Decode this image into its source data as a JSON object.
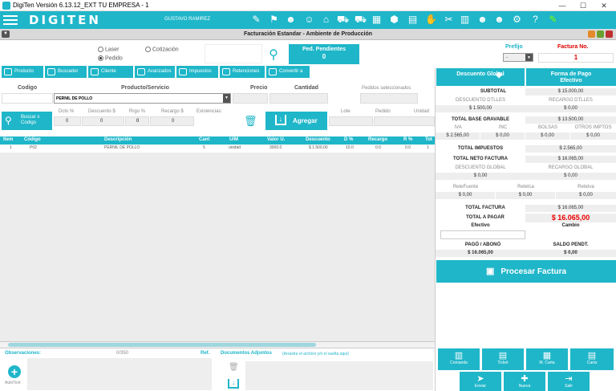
{
  "window": {
    "title": "DigiTen Versión 6.13.12_EXT TU EMPRESA - 1"
  },
  "app": {
    "logo": "DIGITEN",
    "user": "GUSTAVO RAMIREZ",
    "toolbar_icons": [
      "notes-icon",
      "ticket-icon",
      "users-icon",
      "search-users-icon",
      "tag-icon",
      "cart-icon",
      "cart-settings-icon",
      "box-icon",
      "cube-icon",
      "chart-icon",
      "hand-coins-icon",
      "tools-icon",
      "bar-chart-icon",
      "person-icon",
      "admin-icon",
      "gear-icon",
      "help-icon",
      "pen-icon"
    ]
  },
  "doc": {
    "title": "Facturación Estandar  -  Ambiente de Producción"
  },
  "modes": {
    "laser": "Laser",
    "cotizacion": "Cotización",
    "pedido": "Pedido"
  },
  "pedidos": {
    "label": "Ped. Pendientes",
    "count": "0"
  },
  "prefijo": {
    "label": "Prefijo",
    "value": "-"
  },
  "factura": {
    "label": "Factura No.",
    "value": "1"
  },
  "tabs": [
    "Producto",
    "Buscador",
    "Cliente",
    "Avanzados",
    "Impuestos",
    "Retenciones",
    "Convertir a FE"
  ],
  "form": {
    "codigo": "Codigo",
    "producto": "Producto/Servicio",
    "precio": "Precio",
    "cantidad": "Cantidad",
    "pedidos_sel": "Pedidos seleccionados",
    "product_value": "PERNIL DE POLLO",
    "buscar": "Buscar x Codigo",
    "dcto_pct": "Dcto %",
    "descuento": "Descuento $",
    "rrgo_pct": "Rrgo %",
    "recargo": "Recargo $",
    "existencias": "Existencias:",
    "dcto_val": "0",
    "desc_val": "0",
    "rrgo_val": "0",
    "rec_val": "0",
    "lote": "Lote",
    "pedido": "Pedido",
    "unidad": "Unidad",
    "agregar": "Agregar"
  },
  "grid": {
    "columns": [
      "Item",
      "Código",
      "Descripción",
      "Cant",
      "U/M",
      "Valor U.",
      "Descuento",
      "D %",
      "Recargo",
      "R %",
      "Tot"
    ],
    "rows": [
      [
        "1",
        "P02",
        "PERNIL DE POLLO",
        "5",
        "unidad",
        "3000.0",
        "$ 1.500,00",
        "10.0",
        "0.0",
        "0.0",
        "1"
      ]
    ]
  },
  "bottom": {
    "obs": "Observaciones:",
    "count": "0/350",
    "ref": "Ref.",
    "docs": "Documentos Adjuntos",
    "docs_hint": "(Arrastra el archivo y/o el suelta aquí)",
    "autotext": "AutoText"
  },
  "summary": {
    "descuento_global": "Descuento Global",
    "forma_pago": "Forma de Pago Efectivo",
    "subtotal_l": "SUBTOTAL",
    "subtotal": "$ 15.000,00",
    "desc_dtlles_l": "DESCUENTO DTLLES",
    "desc_dtlles": "$ 1.500,00",
    "rec_dtlles_l": "RECARGO DTLLES",
    "rec_dtlles": "$ 0,00",
    "base_l": "TOTAL BASE GRAVABLE",
    "base": "$ 13.500,00",
    "iva_l": "IVA",
    "iva": "$ 2.565,00",
    "inc_l": "INC",
    "inc": "$ 0,00",
    "bolsas_l": "BOLSAS",
    "bolsas": "$ 0,00",
    "otros_l": "OTROS IMPTOS",
    "otros": "$ 0,00",
    "imp_l": "TOTAL IMPUESTOS",
    "imp": "$ 2.565,00",
    "neto_l": "TOTAL NETO FACTURA",
    "neto": "$ 16.065,00",
    "dg_l": "DESCUENTO GLOBAL",
    "dg": "$ 0,00",
    "rg_l": "RECARGO GLOBAL",
    "rg": "$ 0,00",
    "retef_l": "ReteFuente",
    "retef": "$ 0,00",
    "reteica_l": "ReteIca",
    "reteica": "$ 0,00",
    "reteiva_l": "ReteIva",
    "reteiva": "$ 0,00",
    "total_l": "TOTAL FACTURA",
    "total": "$ 16.065,00",
    "pagar_l": "TOTAL A PAGAR",
    "pagar": "$ 16.065,00",
    "efectivo_l": "Efectivo",
    "cambio_l": "Cambio",
    "pago_l": "PAGÓ / ABONÓ",
    "pago": "$ 16.065,00",
    "saldo_l": "SALDO PENDT.",
    "saldo": "$ 0,00",
    "procesar": "Procesar Factura"
  },
  "actions": [
    "Comanda",
    "Ticket",
    "M. Carta",
    "Carta",
    "Enviar",
    "Nueva",
    "Salir"
  ]
}
